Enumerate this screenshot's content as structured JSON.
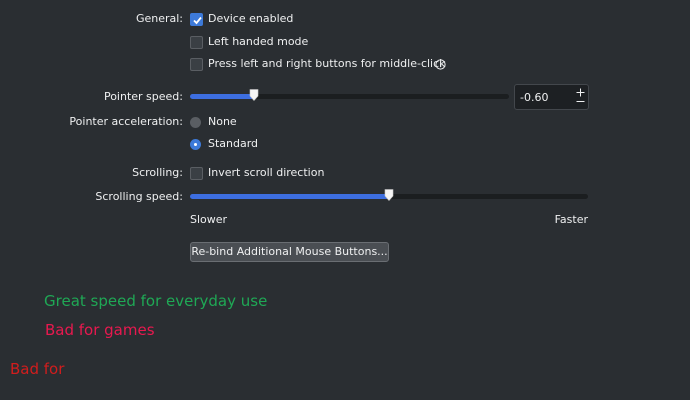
{
  "general": {
    "label": "General:",
    "device_enabled": {
      "label": "Device enabled",
      "checked": true
    },
    "left_handed": {
      "label": "Left handed mode",
      "checked": false
    },
    "middle_click": {
      "label": "Press left and right buttons for middle-click",
      "checked": false,
      "info_icon": "info-icon"
    }
  },
  "pointer_speed": {
    "label": "Pointer speed:",
    "value_text": "-0.60",
    "slider_fraction": 0.2,
    "increment_icon": "plus-icon",
    "decrement_icon": "minus-icon"
  },
  "pointer_acceleration": {
    "label": "Pointer acceleration:",
    "options": [
      {
        "label": "None",
        "selected": false
      },
      {
        "label": "Standard",
        "selected": true
      }
    ]
  },
  "scrolling": {
    "label": "Scrolling:",
    "invert": {
      "label": "Invert scroll direction",
      "checked": false
    }
  },
  "scrolling_speed": {
    "label": "Scrolling speed:",
    "slider_fraction": 0.5,
    "min_label": "Slower",
    "max_label": "Faster"
  },
  "rebind_button": {
    "label": "Re-bind Additional Mouse Buttons..."
  },
  "annotations": [
    {
      "text": "Great speed for everyday use",
      "color": "#1fa855"
    },
    {
      "text": "Bad for games",
      "color": "#e8194f"
    },
    {
      "text": "Bad for",
      "color": "#d11d1d"
    }
  ],
  "colors": {
    "background": "#2a2e32",
    "accent": "#3d7ad9",
    "text": "#eff0f1"
  }
}
